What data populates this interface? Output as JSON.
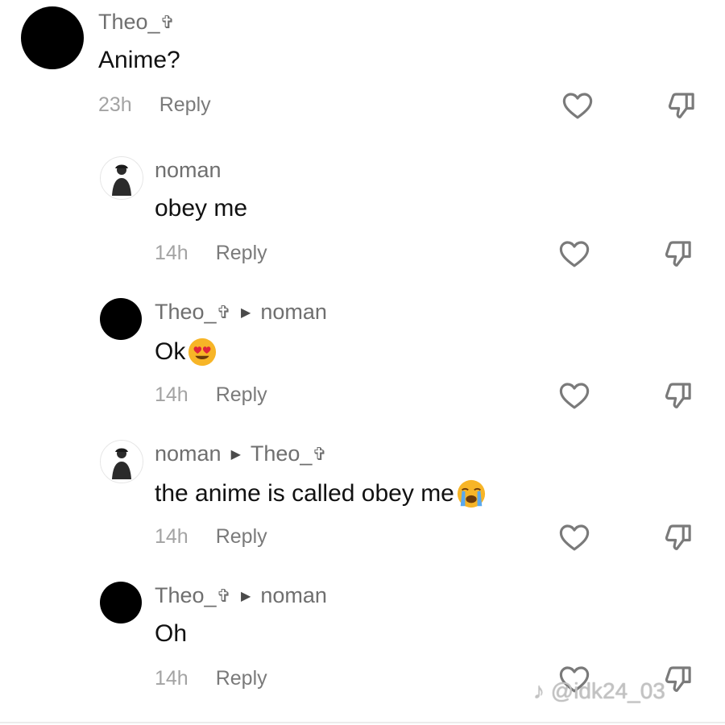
{
  "comments": [
    {
      "username": "Theo_",
      "badge": "✞",
      "reply_to": "",
      "text": "Anime?",
      "emoji": "",
      "time": "23h",
      "reply_label": "Reply",
      "avatar": "black"
    },
    {
      "username": "noman",
      "badge": "",
      "reply_to": "",
      "text": "obey me",
      "emoji": "",
      "time": "14h",
      "reply_label": "Reply",
      "avatar": "photo"
    },
    {
      "username": "Theo_",
      "badge": "✞",
      "reply_to": "noman",
      "text": "Ok",
      "emoji": "heart-eyes-emoji",
      "time": "14h",
      "reply_label": "Reply",
      "avatar": "black"
    },
    {
      "username": "noman",
      "badge": "",
      "reply_to": "Theo_",
      "reply_to_badge": "✞",
      "text": "the anime is called obey me",
      "emoji": "crying-emoji",
      "time": "14h",
      "reply_label": "Reply",
      "avatar": "photo"
    },
    {
      "username": "Theo_",
      "badge": "✞",
      "reply_to": "noman",
      "text": "Oh",
      "emoji": "",
      "time": "14h",
      "reply_label": "Reply",
      "avatar": "black"
    }
  ],
  "watermark": "@idk24_03",
  "icons": {
    "like": "heart-outline-icon",
    "dislike": "thumbs-down-outline-icon"
  },
  "colors": {
    "username": "#6f6f6f",
    "text": "#111111",
    "time": "#a3a3a3",
    "reply": "#7a7a7a"
  }
}
